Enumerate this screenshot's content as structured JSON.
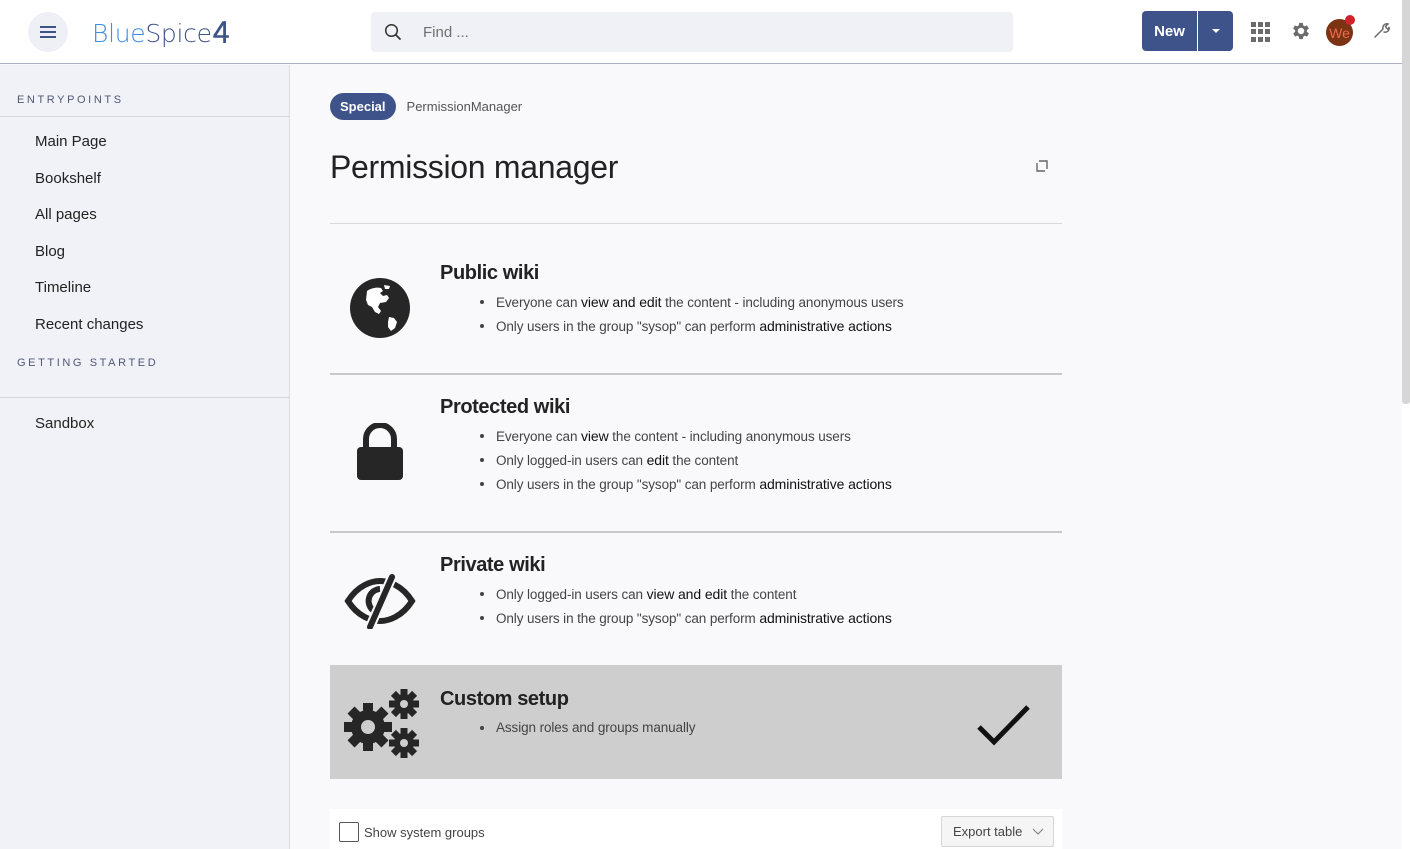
{
  "header": {
    "logo": {
      "part1": "Blue",
      "part2": "Spice",
      "part3": "4"
    },
    "search": {
      "placeholder": "Find ...",
      "value": ""
    },
    "new_button": {
      "label": "New"
    },
    "avatar": {
      "initials": "We",
      "has_notification": true
    },
    "icons": [
      "menu-icon",
      "search-icon",
      "apps-grid-icon",
      "gear-icon",
      "wrench-icon"
    ]
  },
  "sidebar": {
    "sections": [
      {
        "heading": "Entrypoints",
        "items": [
          {
            "label": "Main Page"
          },
          {
            "label": "Bookshelf"
          },
          {
            "label": "All pages"
          },
          {
            "label": "Blog"
          },
          {
            "label": "Timeline"
          },
          {
            "label": "Recent changes"
          }
        ]
      },
      {
        "heading": "Getting started",
        "items": [
          {
            "label": "Sandbox"
          }
        ]
      }
    ]
  },
  "main": {
    "breadcrumb": {
      "namespace": "Special",
      "page": "PermissionManager"
    },
    "title": "Permission manager",
    "options": [
      {
        "id": "public",
        "title": "Public wiki",
        "icon": "globe-icon",
        "selected": false,
        "bullets": [
          {
            "pre": "Everyone can ",
            "bold": "view and edit",
            "post": " the content - including anonymous users"
          },
          {
            "pre": "Only users in the group \"sysop\" can perform ",
            "bold": "administrative actions",
            "post": ""
          }
        ]
      },
      {
        "id": "protected",
        "title": "Protected wiki",
        "icon": "lock-icon",
        "selected": false,
        "bullets": [
          {
            "pre": "Everyone can ",
            "bold": "view",
            "post": " the content - including anonymous users"
          },
          {
            "pre": "Only logged-in users can ",
            "bold": "edit",
            "post": " the content"
          },
          {
            "pre": "Only users in the group \"sysop\" can perform ",
            "bold": "administrative actions",
            "post": ""
          }
        ]
      },
      {
        "id": "private",
        "title": "Private wiki",
        "icon": "eye-slash-icon",
        "selected": false,
        "bullets": [
          {
            "pre": "Only logged-in users can ",
            "bold": "view and edit",
            "post": " the content"
          },
          {
            "pre": "Only users in the group \"sysop\" can perform ",
            "bold": "administrative actions",
            "post": ""
          }
        ]
      },
      {
        "id": "custom",
        "title": "Custom setup",
        "icon": "gears-icon",
        "selected": true,
        "bullets": [
          {
            "pre": "Assign roles and groups manually",
            "bold": "",
            "post": ""
          }
        ]
      }
    ],
    "toolbar": {
      "show_system_groups": {
        "label": "Show system groups",
        "checked": false
      },
      "export": {
        "label": "Export table"
      }
    }
  },
  "colors": {
    "brand": "#3e5389",
    "logo_blue": "#3d8ee5",
    "selected_option_bg": "#cecece",
    "avatar_bg": "#7a3313",
    "notification": "#d2222d"
  }
}
